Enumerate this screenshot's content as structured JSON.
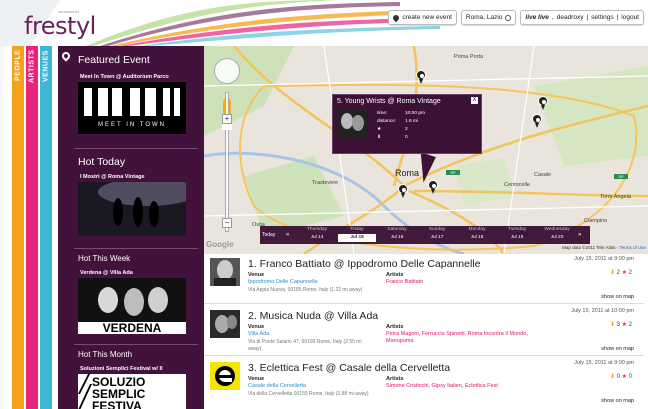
{
  "app": {
    "logo": "frestyl",
    "logo_sub": "ohrmuschel"
  },
  "topbar": {
    "create_event": "create new event",
    "location": "Roma, Lazio",
    "live_prefix": "live live",
    "user": "deadroxy",
    "settings": "settings",
    "logout": "logout"
  },
  "tabs": [
    "PEOPLE",
    "ARTISTS",
    "VENUES"
  ],
  "sidebar": {
    "featured_heading": "Featured Event",
    "featured_title": "Meet In Town @ Auditorium Parco",
    "featured_banner": "MEET IN TOWN",
    "hot_today_heading": "Hot Today",
    "hot_today_title": "I Mostri @ Roma Vintage",
    "hot_week_heading": "Hot This Week",
    "hot_week_title": "Verdena @ Villa Ada",
    "hot_month_heading": "Hot This Month",
    "hot_month_title": "Soluzioni Semplici Festival w/ Il",
    "hot_month_banner": [
      "SOLUZIO",
      "SEMPLIC",
      "FESTIVA"
    ]
  },
  "map": {
    "city": "Roma",
    "labels": [
      "Trastevere",
      "Casale",
      "Prima Porta",
      "Torre Angela",
      "Centocelle",
      "Ciampino",
      "Ostia"
    ],
    "zoom_plus": "+",
    "zoom_minus": "−",
    "google": "Google",
    "map_data": "Map data ©2011 Tele Atlas -",
    "terms": "Terms of Use",
    "popup": {
      "title": "5. Young Wrists @ Roma Vintage",
      "close": "X",
      "time_label": "time:",
      "time_value": "10:00 pm",
      "distance_label": "distance:",
      "distance_value": "1.6 mi",
      "votes_up": "2",
      "votes_down": "0"
    },
    "days": {
      "today": "Today",
      "prev": "«",
      "next": "»",
      "items": [
        {
          "name": "Thursday",
          "date": "Jul 14"
        },
        {
          "name": "Friday",
          "date": "Jul 15"
        },
        {
          "name": "Saturday",
          "date": "Jul 16"
        },
        {
          "name": "Sunday",
          "date": "Jul 17"
        },
        {
          "name": "Monday",
          "date": "Jul 18"
        },
        {
          "name": "Tuesday",
          "date": "Jul 19"
        },
        {
          "name": "Wednesday",
          "date": "Jul 20"
        }
      ],
      "selected": "Jul 15"
    }
  },
  "events": [
    {
      "title": "1. Franco Battiato @ Ippodromo Delle Capannelle",
      "date": "July 15, 2011 at 9:00 pm",
      "up": "2",
      "down": "2",
      "venue_label": "Venue",
      "venue": "Ippodromo Delle Capannelle",
      "address": "Via Appia Nuova, 00185 Rome, Italy (1.22 mi away)",
      "artists_label": "Artists",
      "artists": "Franco Battiato",
      "show_on_map": "show on map"
    },
    {
      "title": "2. Musica Nuda @ Villa Ada",
      "date": "July 15, 2011 at 10:00 pm",
      "up": "3",
      "down": "2",
      "venue_label": "Venue",
      "venue": "Villa Ada",
      "address": "Via di Ponte Salario 47, 00199 Rome, Italy (2.55 mi away)",
      "artists_label": "Artists",
      "artists": "Petra Magoni, Ferruccio Spinetti, Roma Incontra Il Mondo, Manupuma",
      "show_on_map": "show on map"
    },
    {
      "title": "3. Eclettica Fest @ Casale della Cervelletta",
      "date": "July 15, 2011 at 9:00 pm",
      "up": "0",
      "down": "0",
      "venue_label": "Venue",
      "venue": "Casale della Cervelletta",
      "address": "Via della Cervelletta 00155 Rome, Italy (3.88 mi away)",
      "artists_label": "Artists",
      "artists": "Simone Cristicchi, Gipsy Italien, Eclettica Fest",
      "show_on_map": "show on map"
    }
  ],
  "colors": {
    "purple": "#42123c",
    "orange": "#f6a11a",
    "pink": "#e8237a",
    "cyan": "#3fb6d4",
    "link": "#2a8fd0"
  }
}
